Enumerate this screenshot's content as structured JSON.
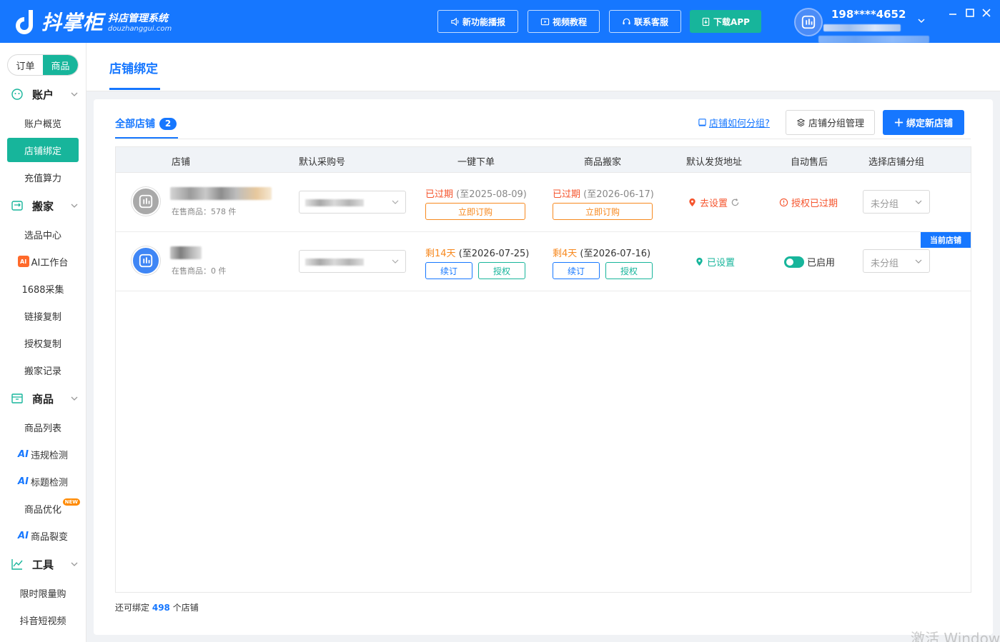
{
  "header": {
    "logo_text": "抖掌柜",
    "logo_sub": "抖店管理系统",
    "logo_domain": "douzhanggui.com",
    "buttons": [
      {
        "label": "新功能播报",
        "icon": "speaker-icon"
      },
      {
        "label": "视频教程",
        "icon": "video-icon"
      },
      {
        "label": "联系客服",
        "icon": "headset-icon"
      },
      {
        "label": "下载APP",
        "icon": "download-icon"
      }
    ],
    "user_phone": "198****4652"
  },
  "sidebar": {
    "mode_tabs": [
      "订单",
      "商品"
    ],
    "active_mode": "商品",
    "groups": [
      {
        "label": "账户",
        "icon": "smile-icon",
        "items": [
          "账户概览",
          "店铺绑定",
          "充值算力"
        ]
      },
      {
        "label": "搬家",
        "icon": "move-icon",
        "items": [
          "选品中心",
          "AI工作台",
          "1688采集",
          "链接复制",
          "授权复制",
          "搬家记录"
        ]
      },
      {
        "label": "商品",
        "icon": "box-icon",
        "items": [
          "商品列表",
          "违规检测",
          "标题检测",
          "商品优化",
          "商品裂变"
        ]
      },
      {
        "label": "工具",
        "icon": "chart-line-icon",
        "items": [
          "限时限量购",
          "抖音短视频"
        ]
      }
    ],
    "active_item": "店铺绑定",
    "ai_prefix": "AI",
    "new_badge": "NEW"
  },
  "page": {
    "title": "店铺绑定",
    "all_shops_label": "全部店铺",
    "all_shops_count": "2",
    "help_link": "店铺如何分组?",
    "group_manage_button": "店铺分组管理",
    "bind_button": "绑定新店铺",
    "columns": [
      "店铺",
      "默认采购号",
      "一键下单",
      "商品搬家",
      "默认发货地址",
      "自动售后",
      "选择店铺分组"
    ],
    "rows": [
      {
        "on_sale": "在售商品：578 件",
        "order_status": "已过期",
        "order_until": "(至2025-08-09)",
        "order_button": "立即订购",
        "move_status": "已过期",
        "move_until": "(至2026-06-17)",
        "move_button": "立即订购",
        "address_status": "去设置",
        "aftersale_status": "授权已过期",
        "group": "未分组"
      },
      {
        "on_sale": "在售商品：0 件",
        "order_status": "剩14天",
        "order_until": "(至2026-07-25)",
        "order_renew": "续订",
        "order_auth": "授权",
        "move_status": "剩4天",
        "move_until": "(至2026-07-16)",
        "move_renew": "续订",
        "move_auth": "授权",
        "address_status": "已设置",
        "aftersale_status": "已启用",
        "group": "未分组",
        "current_tag": "当前店铺"
      }
    ],
    "footer_prefix": "还可绑定",
    "footer_count": "498",
    "footer_suffix": "个店铺"
  },
  "watermark": "激活 Window",
  "colors": {
    "brand_blue": "#1677ff",
    "teal": "#17b59b",
    "orange": "#f7891f",
    "red": "#f5542d"
  }
}
